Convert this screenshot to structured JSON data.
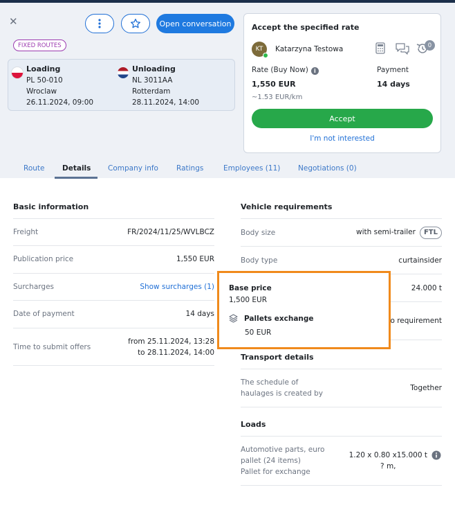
{
  "header": {
    "more_icon": "more-vertical-icon",
    "star_icon": "star-icon",
    "open_conversation": "Open conversation",
    "badge": "FIXED ROUTES"
  },
  "route": {
    "loading": {
      "title": "Loading",
      "postal": "PL 50-010",
      "city": "Wroclaw",
      "date": "26.11.2024, 09:00"
    },
    "unloading": {
      "title": "Unloading",
      "postal": "NL 3011AA",
      "city": "Rotterdam",
      "date": "28.11.2024, 14:00"
    }
  },
  "offer": {
    "title": "Accept the specified rate",
    "avatar_initials": "KT",
    "user_name": "Katarzyna Testowa",
    "counter": "0",
    "rate_label": "Rate (Buy Now)",
    "rate_value": "1,550 EUR",
    "rate_per_km": "~1.53 EUR/km",
    "payment_label": "Payment",
    "payment_value": "14 days",
    "accept_label": "Accept",
    "not_interested": "I'm not interested"
  },
  "tabs": [
    {
      "label": "Route"
    },
    {
      "label": "Details"
    },
    {
      "label": "Company info"
    },
    {
      "label": "Ratings"
    },
    {
      "label": "Employees (11)"
    },
    {
      "label": "Negotiations (0)"
    }
  ],
  "basic": {
    "title": "Basic information",
    "rows": [
      {
        "label": "Freight",
        "value": "FR/2024/11/25/WVLBCZ"
      },
      {
        "label": "Publication price",
        "value": "1,550 EUR"
      },
      {
        "label": "Surcharges",
        "value": "Show surcharges (1)"
      },
      {
        "label": "Date of payment",
        "value": "14 days"
      },
      {
        "label": "Time to submit offers",
        "value1": "from 25.11.2024, 13:28",
        "value2": "to 28.11.2024, 14:00"
      }
    ]
  },
  "vehicle": {
    "title": "Vehicle requirements",
    "body_size_label": "Body size",
    "body_size_value": "with semi-trailer",
    "body_size_tag": "FTL",
    "body_type_label": "Body type",
    "body_type_value": "curtainsider",
    "capacity_value": "24.000 t",
    "requirement_value": "No requirement"
  },
  "transport": {
    "title": "Transport details",
    "schedule_label_1": "The schedule of",
    "schedule_label_2": "haulages is created by",
    "schedule_value": "Together"
  },
  "loads": {
    "title": "Loads",
    "desc_1": "Automotive parts, euro",
    "desc_2": "pallet (24 items)",
    "desc_3": "Pallet for exchange",
    "dims_1": "1.20 x 0.80 x15.000 t",
    "dims_2": "? m,"
  },
  "surcharge_popup": {
    "base_label": "Base price",
    "base_value": "1,500 EUR",
    "item_label": "Pallets exchange",
    "item_value": "50 EUR"
  }
}
